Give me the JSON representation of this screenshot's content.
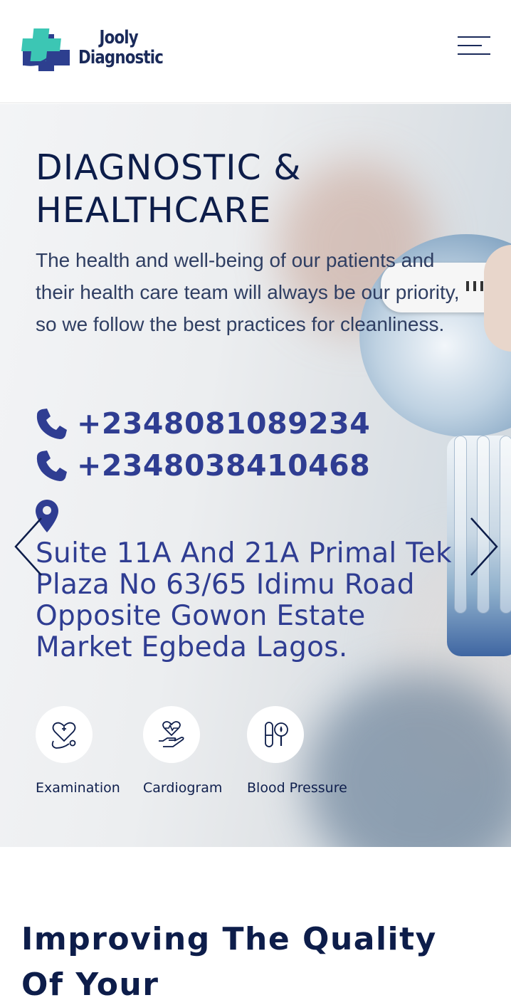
{
  "header": {
    "logo_line1": "Jooly",
    "logo_line2": "Diagnostic",
    "menu_icon": "hamburger-menu-icon"
  },
  "hero": {
    "title": "DIAGNOSTIC & HEALTHCARE",
    "description": "The health and well-being of our patients and their health care team will always be our priority, so we follow the best practices for cleanliness.",
    "phones": [
      "+2348081089234",
      "+2348038410468"
    ],
    "address": "Suite 11A And 21A Primal Tek Plaza No 63/65 Idimu Road Opposite Gowon Estate Market Egbeda Lagos.",
    "icons": {
      "phone": "phone-icon",
      "location": "location-pin-icon",
      "prev": "chevron-left-icon",
      "next": "chevron-right-icon"
    },
    "services": [
      {
        "label": "Examination",
        "icon": "heart-stethoscope-icon"
      },
      {
        "label": "Cardiogram",
        "icon": "heart-in-hand-icon"
      },
      {
        "label": "Blood Pressure",
        "icon": "test-tube-blood-drop-icon"
      }
    ]
  },
  "section": {
    "title": "Improving The Quality Of Your"
  },
  "colors": {
    "navy": "#0d1d4a",
    "accent_blue": "#2f3d92",
    "logo_teal": "#3cc6b4",
    "logo_navy": "#2d3f8f"
  }
}
